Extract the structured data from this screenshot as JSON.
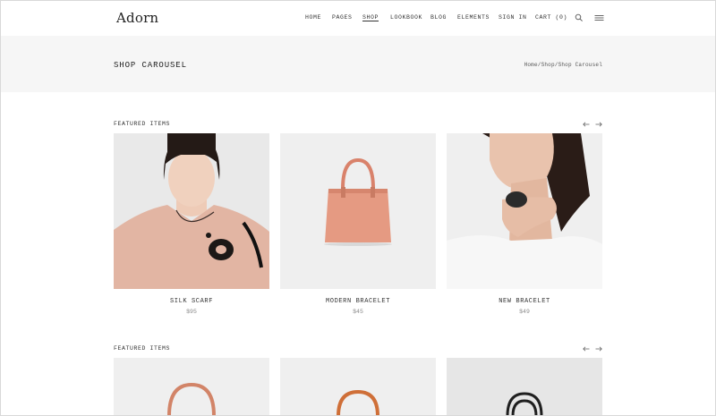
{
  "header": {
    "logo": "Adorn",
    "nav": [
      {
        "label": "HOME",
        "active": false
      },
      {
        "label": "PAGES",
        "active": false
      },
      {
        "label": "SHOP",
        "active": true
      },
      {
        "label": "LOOKBOOK",
        "active": false
      },
      {
        "label": "BLOG",
        "active": false
      },
      {
        "label": "ELEMENTS",
        "active": false
      },
      {
        "label": "SIGN IN",
        "active": false
      },
      {
        "label": "CART (0)",
        "active": false
      }
    ],
    "icons": [
      "search-icon",
      "menu-icon"
    ]
  },
  "title_band": {
    "title": "SHOP CAROUSEL",
    "breadcrumb": "Home/Shop/Shop Carousel"
  },
  "sections": [
    {
      "title": "FEATURED ITEMS",
      "products": [
        {
          "name": "SILK SCARF",
          "price": "$95",
          "image": "woman-necklace-photo"
        },
        {
          "name": "MODERN BRACELET",
          "price": "$45",
          "image": "pink-handbag-photo"
        },
        {
          "name": "NEW BRACELET",
          "price": "$49",
          "image": "woman-ring-photo"
        }
      ]
    },
    {
      "title": "FEATURED ITEMS",
      "products": [
        {
          "image": "handbag-photo"
        },
        {
          "image": "orange-handbag-photo"
        },
        {
          "image": "black-bag-photo"
        }
      ]
    }
  ],
  "colors": {
    "title_band_bg": "#f6f6f6",
    "image_bg": "#efefef",
    "text": "#333333",
    "price": "#888888"
  }
}
